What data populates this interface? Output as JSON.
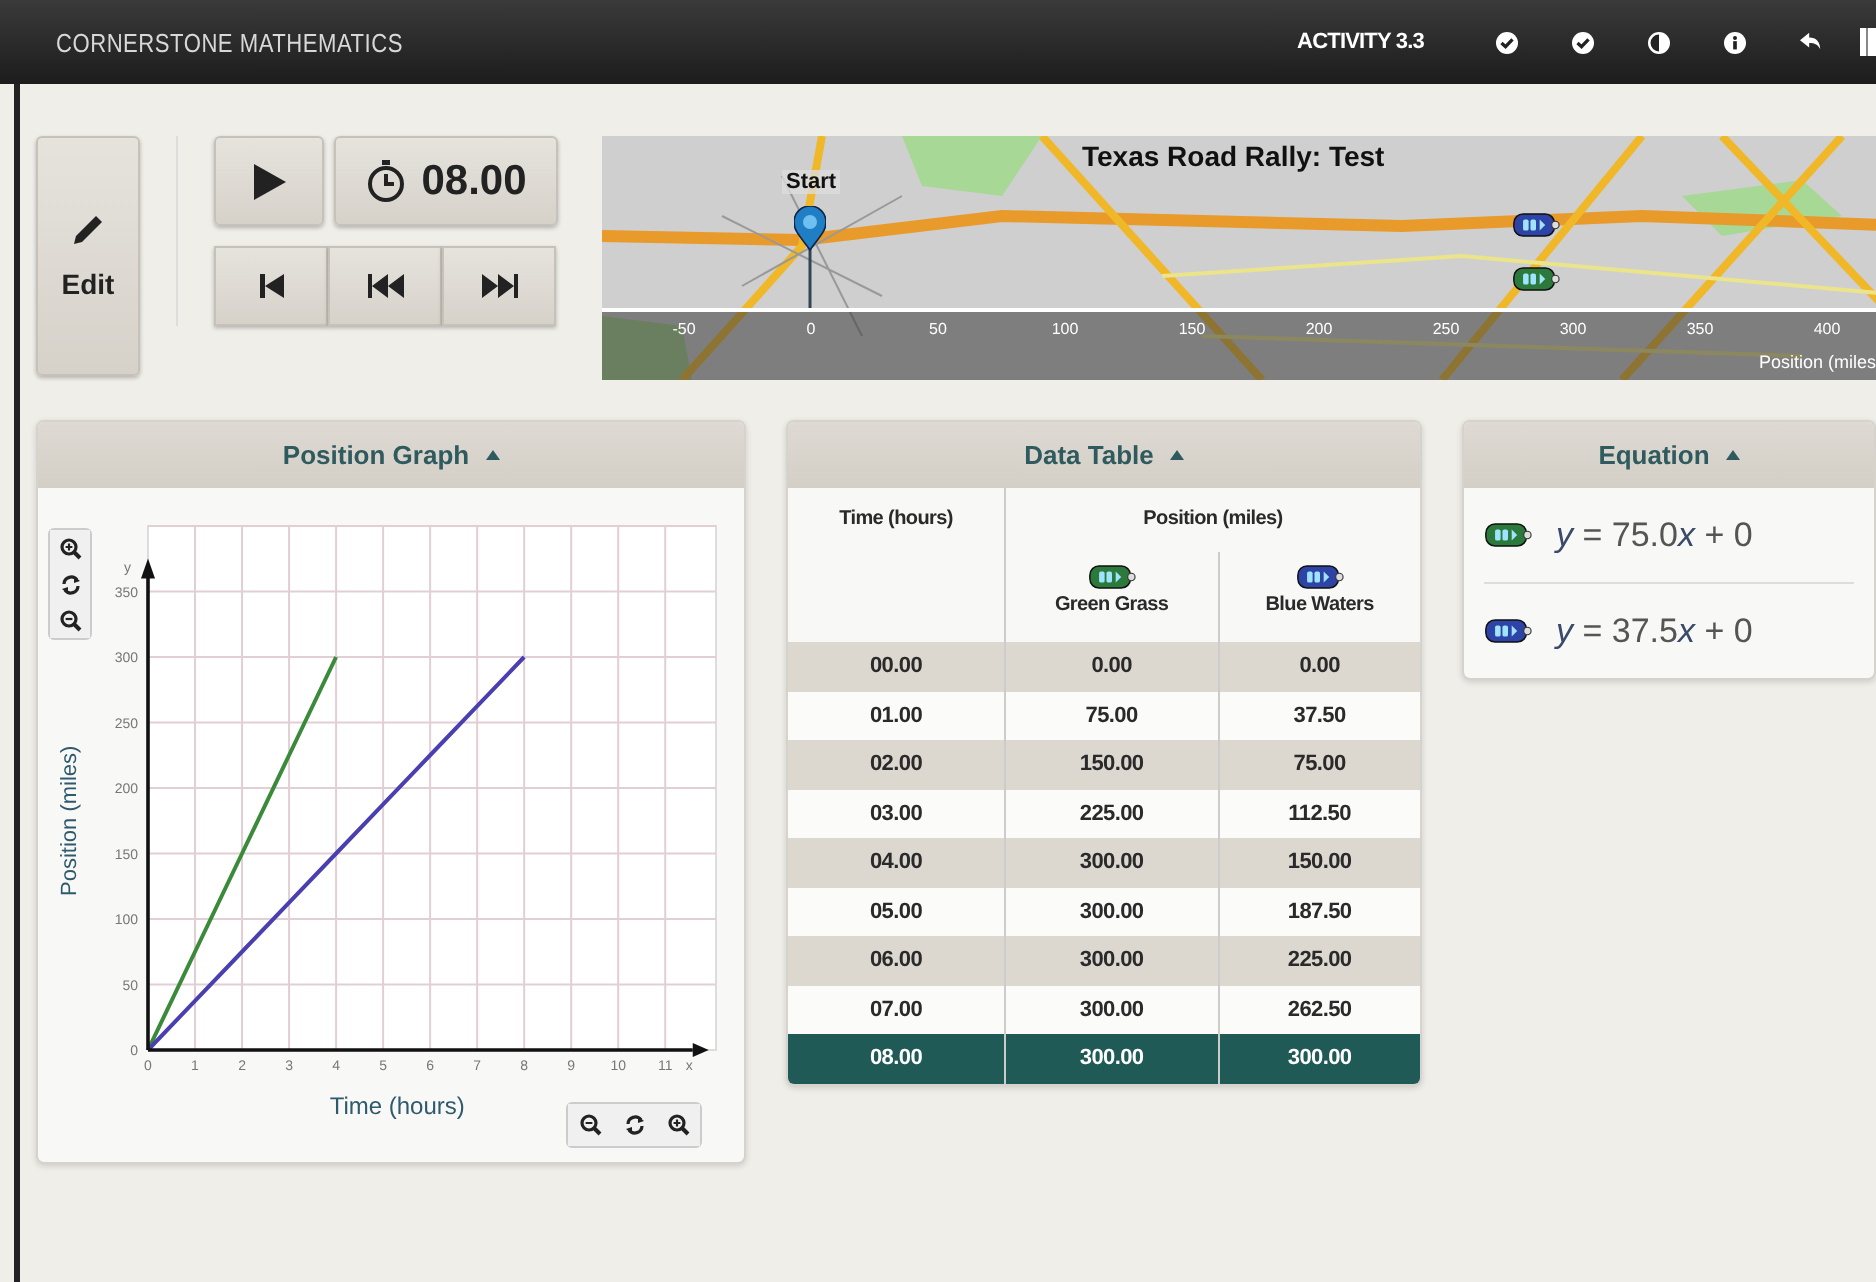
{
  "top_bar": {
    "brand": "CORNERSTONE MATHEMATICS",
    "activity": "ACTIVITY 3.3"
  },
  "controls": {
    "edit_label": "Edit",
    "timer": "08.00"
  },
  "map": {
    "title": "Texas Road Rally: Test",
    "start_label": "Start",
    "scale_ticks": [
      "-50",
      "0",
      "50",
      "100",
      "150",
      "200",
      "250",
      "300",
      "350",
      "400"
    ],
    "scale_label": "Position (miles",
    "cars": [
      {
        "color": "#2d43a6"
      },
      {
        "color": "#2b7a3b"
      }
    ]
  },
  "position_graph": {
    "title": "Position Graph",
    "x_axis_letter": "x",
    "y_axis_letter": "y",
    "chart_data": {
      "type": "line",
      "xlabel": "Time (hours)",
      "ylabel": "Position (miles)",
      "grid": true,
      "x": [
        0,
        1,
        2,
        3,
        4,
        5,
        6,
        7,
        8
      ],
      "series": [
        {
          "color": "#3a8a3a",
          "values": [
            0,
            75,
            150,
            225,
            300,
            null,
            null,
            null,
            null
          ]
        },
        {
          "color": "#4a3fb0",
          "values": [
            0,
            37.5,
            75,
            112.5,
            150,
            187.5,
            225,
            262.5,
            300
          ]
        }
      ],
      "xlim": [
        0,
        11.5
      ],
      "ylim": [
        0,
        360
      ],
      "xticks": [
        {
          "value": 0,
          "label": "0"
        },
        {
          "value": 1,
          "label": "1"
        },
        {
          "value": 2,
          "label": "2"
        },
        {
          "value": 3,
          "label": "3"
        },
        {
          "value": 4,
          "label": "4"
        },
        {
          "value": 5,
          "label": "5"
        },
        {
          "value": 6,
          "label": "6"
        },
        {
          "value": 7,
          "label": "7"
        },
        {
          "value": 8,
          "label": "8"
        },
        {
          "value": 9,
          "label": "9"
        },
        {
          "value": 10,
          "label": "10"
        },
        {
          "value": 11,
          "label": "11"
        }
      ],
      "yticks": [
        {
          "value": 0,
          "label": "0"
        },
        {
          "value": 50,
          "label": "50"
        },
        {
          "value": 100,
          "label": "100"
        },
        {
          "value": 150,
          "label": "150"
        },
        {
          "value": 200,
          "label": "200"
        },
        {
          "value": 250,
          "label": "250"
        },
        {
          "value": 300,
          "label": "300"
        },
        {
          "value": 350,
          "label": "350"
        }
      ]
    }
  },
  "data_table": {
    "title": "Data Table",
    "header_rows": [
      [
        {
          "label": "Time (hours)",
          "rowspan": 2
        },
        {
          "label": "Position (miles)",
          "colspan": 2
        }
      ],
      [
        {
          "label": "Green Grass",
          "color": "#2b7a3b"
        },
        {
          "label": "Blue Waters",
          "color": "#2d43a6"
        }
      ]
    ],
    "rows": [
      {
        "cells": [
          "00.00",
          "0.00",
          "0.00"
        ],
        "selected": false
      },
      {
        "cells": [
          "01.00",
          "75.00",
          "37.50"
        ],
        "selected": false
      },
      {
        "cells": [
          "02.00",
          "150.00",
          "75.00"
        ],
        "selected": false
      },
      {
        "cells": [
          "03.00",
          "225.00",
          "112.50"
        ],
        "selected": false
      },
      {
        "cells": [
          "04.00",
          "300.00",
          "150.00"
        ],
        "selected": false
      },
      {
        "cells": [
          "05.00",
          "300.00",
          "187.50"
        ],
        "selected": false
      },
      {
        "cells": [
          "06.00",
          "300.00",
          "225.00"
        ],
        "selected": false
      },
      {
        "cells": [
          "07.00",
          "300.00",
          "262.50"
        ],
        "selected": false
      },
      {
        "cells": [
          "08.00",
          "300.00",
          "300.00"
        ],
        "selected": true
      }
    ]
  },
  "equation": {
    "title": "Equation",
    "items": [
      {
        "color": "#2b7a3b",
        "parts": [
          {
            "text": "y",
            "italic": true
          },
          {
            "text": " = 75.0",
            "italic": false
          },
          {
            "text": "x",
            "italic": true
          },
          {
            "text": " + 0",
            "italic": false
          }
        ]
      },
      {
        "color": "#2d43a6",
        "parts": [
          {
            "text": "y",
            "italic": true
          },
          {
            "text": " = 37.5",
            "italic": false
          },
          {
            "text": "x",
            "italic": true
          },
          {
            "text": " + 0",
            "italic": false
          }
        ]
      }
    ]
  }
}
